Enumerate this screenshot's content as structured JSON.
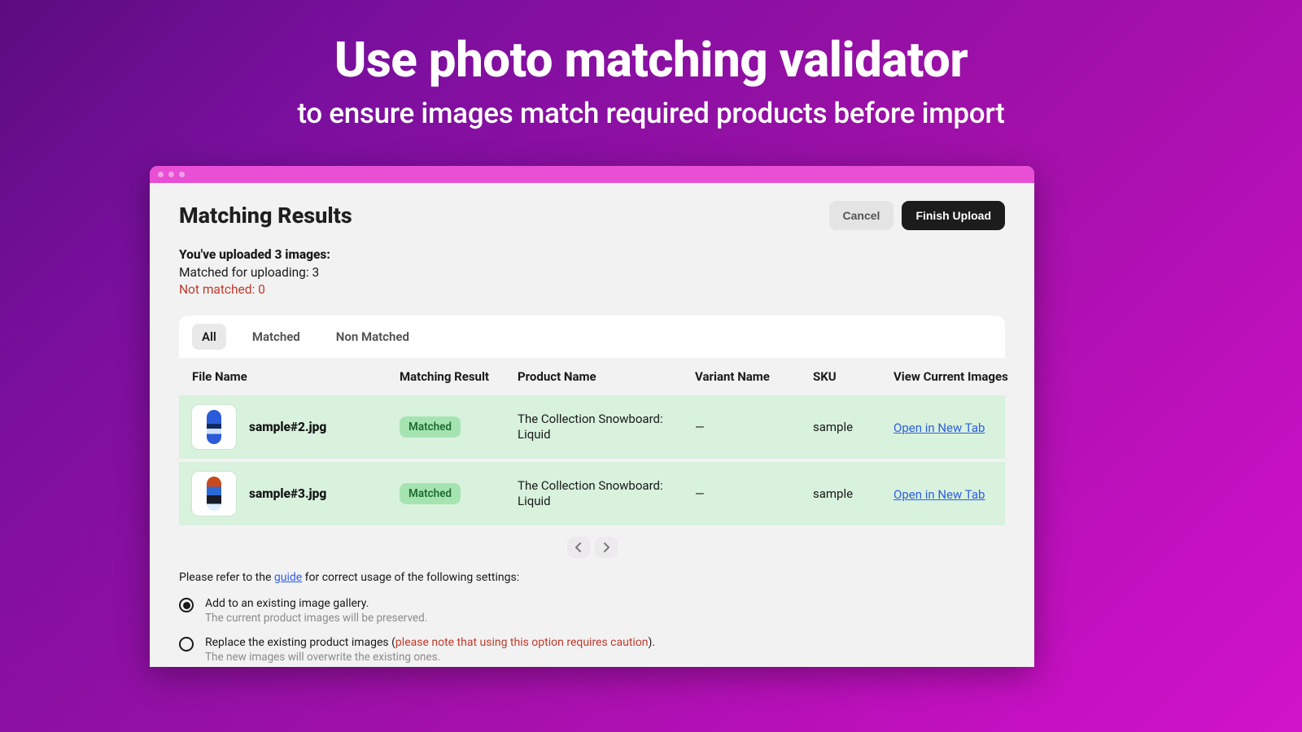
{
  "hero": {
    "title": "Use photo matching validator",
    "subtitle": "to ensure images match required products before import"
  },
  "page_title": "Matching Results",
  "buttons": {
    "cancel": "Cancel",
    "finish": "Finish Upload"
  },
  "summary": {
    "line1": "You've uploaded 3 images:",
    "line2": "Matched for uploading: 3",
    "line3": "Not matched: 0"
  },
  "tabs": {
    "all": "All",
    "matched": "Matched",
    "non_matched": "Non Matched"
  },
  "columns": {
    "file_name": "File Name",
    "matching_result": "Matching Result",
    "product_name": "Product Name",
    "variant_name": "Variant Name",
    "sku": "SKU",
    "view": "View Current Images"
  },
  "rows": [
    {
      "file_name": "sample#2.jpg",
      "badge": "Matched",
      "product_name": "The Collection Snowboard: Liquid",
      "variant_name": "—",
      "sku": "sample",
      "link": "Open in New Tab"
    },
    {
      "file_name": "sample#3.jpg",
      "badge": "Matched",
      "product_name": "The Collection Snowboard: Liquid",
      "variant_name": "—",
      "sku": "sample",
      "link": "Open in New Tab"
    }
  ],
  "note": {
    "prefix": "Please refer to the ",
    "guide": "guide",
    "suffix": " for correct usage of the following settings:"
  },
  "options": {
    "add": {
      "label": "Add to an existing image gallery.",
      "desc": "The current product images will be preserved."
    },
    "replace": {
      "label_pre": "Replace the existing product images (",
      "caution": "please note that using this option requires caution",
      "label_post": ").",
      "desc": "The new images will overwrite the existing ones."
    }
  }
}
